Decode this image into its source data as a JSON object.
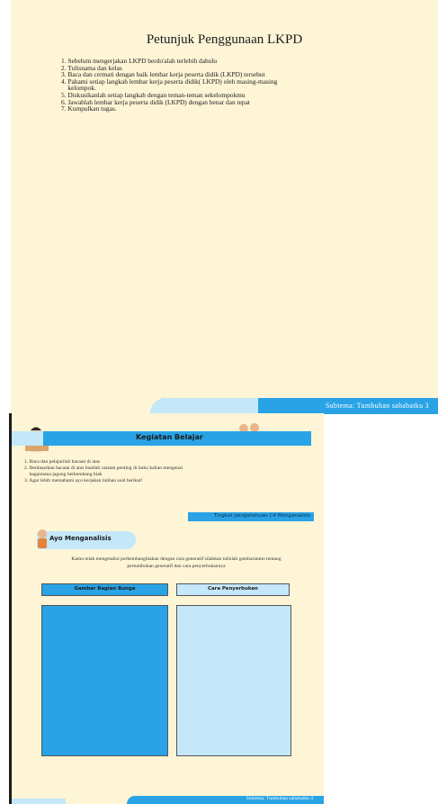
{
  "page1": {
    "title": "Petunjuk Penggunaan LKPD",
    "steps": [
      "1. Sebelum mengerjakan LKPD berdo'alah terlebih dahulu",
      "2. Tulisnama dan kelas",
      "3. Baca dan cermati dengan baik lembar kerja peserta didik (LKPD) tersebut",
      "4. Pahami setiap langkah lembar kerja peserta didik( LKPD) oleh masing-masing",
      "    kelompok.",
      "5. Diskusikanlah setiap langkah dengan teman-teman sekelompokmu",
      "6. Jawablah lembar kerja peserta didik (LKPD) dengan benar dan tepat",
      "7. Kumpulkan tugas."
    ],
    "footer": "Subtema: Tumbuhan sahabatku   3"
  },
  "page2": {
    "header_title": "Kegiatan Belajar",
    "instructions": [
      "1. Baca dan  pelajarilah  bacaan di atas",
      "2. Berdasarkan bacaan di atas buatlah catatan penting di buku kalian  mengenai",
      "    bagaimana jagung berkembang biak",
      "3. Agar lebih memahami ayo kerjakan latihan soal berikut!"
    ],
    "level": "Tingkat pengetahuan  C4 Menganalisis",
    "ayo": "Ayo Menganalisis",
    "task": "Kamu telah mengetahui perkembangbiakan dengan cara generatif silahkan tulislah gambaranmu tentang pertumbuhan generatif dan cara penyerbukannya",
    "col1": "Gambar Bagian Bunga",
    "col2": "Cara Penyerbukan",
    "footer": "Subtema: Tumbuhan sahabatku  4"
  },
  "colors": {
    "blue": "#29a3e6",
    "light_blue": "#c5e7fa",
    "cream": "#fdf5d6"
  }
}
